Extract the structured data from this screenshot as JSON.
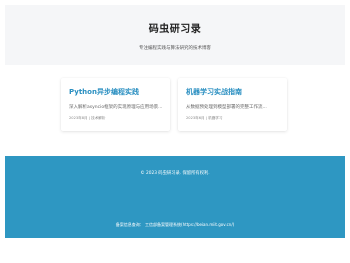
{
  "header": {
    "title": "码虫研习录",
    "subtitle": "专注编程实践与算法研究的技术博客"
  },
  "posts": [
    {
      "title": "Python异步编程实践",
      "excerpt": "深入解析asyncio框架的实现原理与应用场景...",
      "meta": "2023年8月 | 技术解析"
    },
    {
      "title": "机器学习实战指南",
      "excerpt": "从数据预处理到模型部署的完整工作流...",
      "meta": "2023年6月 | 机器学习"
    }
  ],
  "footer": {
    "copyright": "© 2023 码虫研习录. 保留所有权利.",
    "record_label": "备案信息查询：",
    "record_link": "工信部备案管理系统(https://beian.miit.gov.cn/)"
  },
  "colors": {
    "accent": "#2a8fc1",
    "footer_bg": "#2e97c2",
    "header_bg": "#f5f6f8"
  }
}
